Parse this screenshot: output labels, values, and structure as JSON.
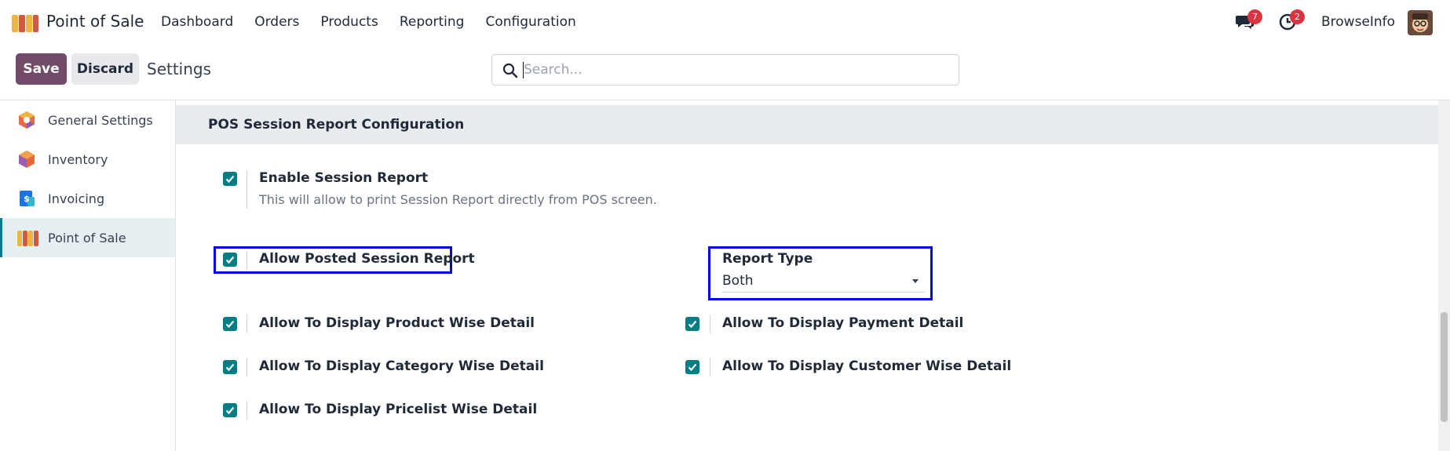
{
  "navbar": {
    "app_name": "Point of Sale",
    "menu": [
      "Dashboard",
      "Orders",
      "Products",
      "Reporting",
      "Configuration"
    ],
    "messages_count": "7",
    "activities_count": "2",
    "user_name": "BrowseInfo"
  },
  "control": {
    "save_label": "Save",
    "discard_label": "Discard",
    "title": "Settings",
    "search_placeholder": "Search..."
  },
  "sidebar": {
    "items": [
      {
        "label": "General Settings",
        "icon": "general-settings-icon"
      },
      {
        "label": "Inventory",
        "icon": "inventory-icon"
      },
      {
        "label": "Invoicing",
        "icon": "invoicing-icon"
      },
      {
        "label": "Point of Sale",
        "icon": "point-of-sale-icon",
        "active": true
      }
    ]
  },
  "section": {
    "title": "POS Session Report Configuration",
    "enable_session": {
      "label": "Enable Session Report",
      "description": "This will allow to print Session Report directly from POS screen.",
      "checked": true
    },
    "allow_posted": {
      "label": "Allow Posted Session Report",
      "checked": true
    },
    "report_type": {
      "label": "Report Type",
      "value": "Both"
    },
    "options": [
      {
        "label": "Allow To Display Product Wise Detail",
        "checked": true
      },
      {
        "label": "Allow To Display Payment Detail",
        "checked": true
      },
      {
        "label": "Allow To Display Category Wise Detail",
        "checked": true
      },
      {
        "label": "Allow To Display Customer Wise Detail",
        "checked": true
      },
      {
        "label": "Allow To Display Pricelist Wise Detail",
        "checked": true
      }
    ]
  },
  "colors": {
    "primary": "#714b67",
    "checkbox": "#017e84",
    "highlight": "#0000ee",
    "badge": "#d9343f"
  }
}
